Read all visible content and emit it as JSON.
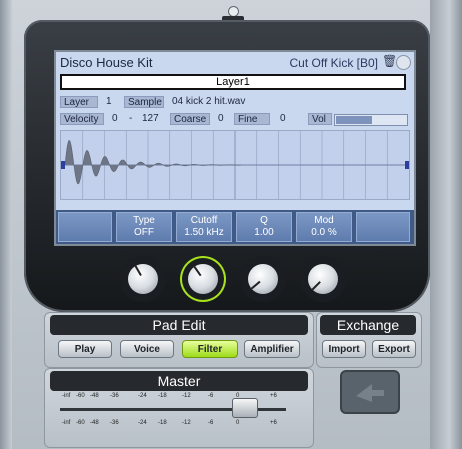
{
  "screen": {
    "kit_name": "Disco House Kit",
    "pad_name": "Cut Off Kick [B0]",
    "layer_label": "Layer1",
    "layer_chip": "Layer",
    "layer_value": "1",
    "sample_chip": "Sample",
    "sample_value": "04 kick 2 hit.wav",
    "velocity_chip": "Velocity",
    "velocity_low": "0",
    "velocity_dash": "-",
    "velocity_high": "127",
    "coarse_chip": "Coarse",
    "coarse_value": "0",
    "fine_chip": "Fine",
    "fine_value": "0",
    "vol_chip": "Vol",
    "vol_level": 0.52
  },
  "params": [
    {
      "label": "Type",
      "value": "OFF"
    },
    {
      "label": "Cutoff",
      "value": "1.50 kHz"
    },
    {
      "label": "Q",
      "value": "1.00"
    },
    {
      "label": "Mod",
      "value": "0.0 %"
    }
  ],
  "pad_edit": {
    "title": "Pad Edit",
    "buttons": [
      "Play",
      "Voice",
      "Filter",
      "Amplifier"
    ],
    "active": "Filter"
  },
  "exchange": {
    "title": "Exchange",
    "import_label": "Import",
    "export_label": "Export"
  },
  "master": {
    "title": "Master",
    "scale": [
      "-inf",
      "-60",
      "-48",
      "-36",
      "-24",
      "-18",
      "-12",
      "-6",
      "0",
      "+6"
    ],
    "fader_level": 0.82
  },
  "icons": [
    "trash-icon",
    "gear-icon",
    "exchange-icon"
  ],
  "colors": {
    "accent_green": "#a8e21c",
    "screen_blue": "#c9d7ef"
  }
}
